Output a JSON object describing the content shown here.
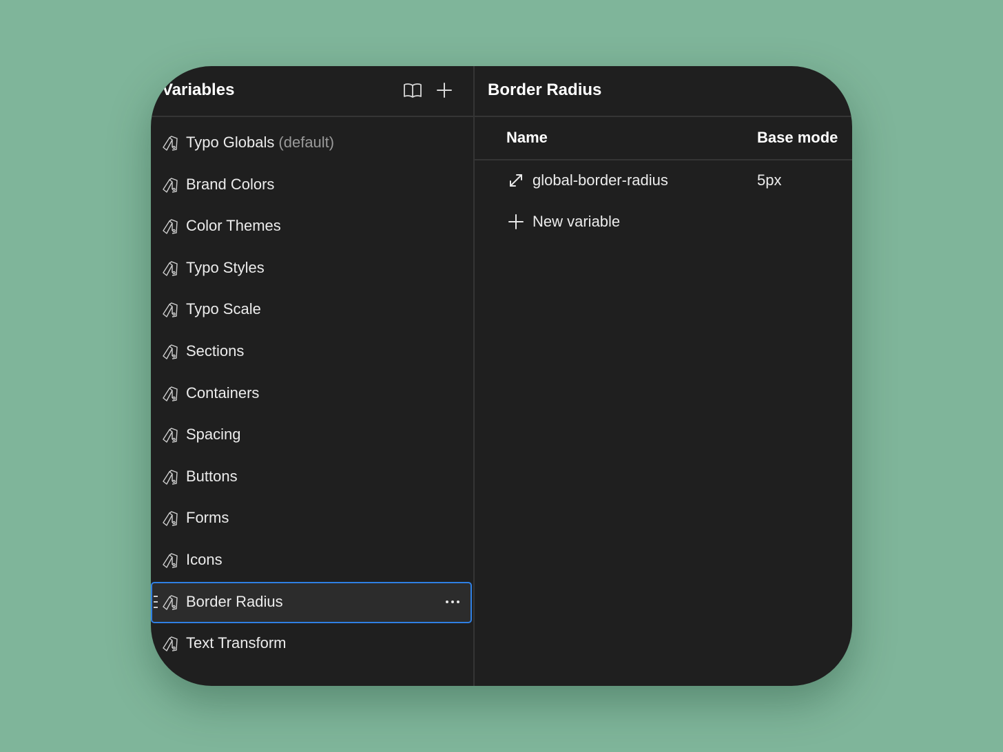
{
  "sidebar": {
    "title": "Variables",
    "header_icons": [
      "book-icon",
      "plus-icon"
    ],
    "collections": [
      {
        "label": "Typo Globals",
        "suffix": "(default)"
      },
      {
        "label": "Brand Colors"
      },
      {
        "label": "Color Themes"
      },
      {
        "label": "Typo Styles"
      },
      {
        "label": "Typo Scale"
      },
      {
        "label": "Sections"
      },
      {
        "label": "Containers"
      },
      {
        "label": "Spacing"
      },
      {
        "label": "Buttons"
      },
      {
        "label": "Forms"
      },
      {
        "label": "Icons"
      },
      {
        "label": "Border Radius",
        "selected": true
      },
      {
        "label": "Text Transform"
      }
    ]
  },
  "main": {
    "title": "Border Radius",
    "columns": {
      "name": "Name",
      "mode": "Base mode"
    },
    "variables": [
      {
        "name": "global-border-radius",
        "value": "5px",
        "icon": "resize-arrow-icon"
      }
    ],
    "new_variable_label": "New variable"
  },
  "colors": {
    "background": "#7fb59a",
    "panel": "#1f1f1f",
    "selection_border": "#2f80e4",
    "text": "#ececec"
  }
}
